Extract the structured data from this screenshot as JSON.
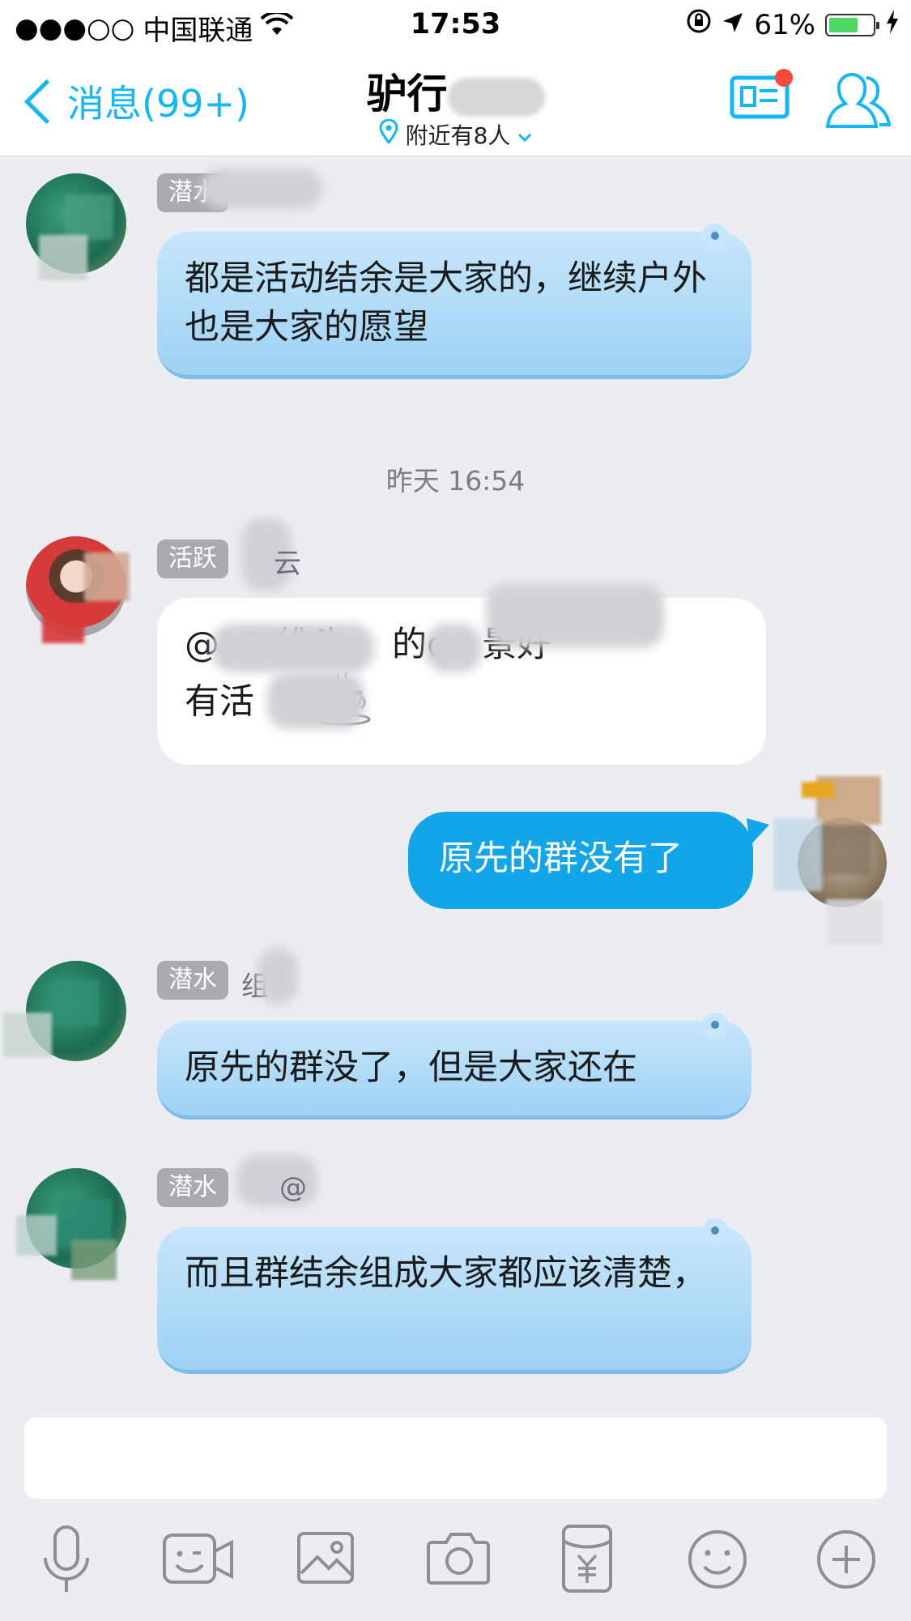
{
  "status_bar": {
    "signal": "●●●○○",
    "carrier": "中国联通",
    "time": "17:53",
    "battery_percent": "61%",
    "battery_level": 0.61
  },
  "nav": {
    "back_label": "消息(99+)",
    "title": "驴行",
    "subtitle": "附近有8人"
  },
  "messages": [
    {
      "sender_badge": "潜水",
      "sender_partial": "潜",
      "text": "都是活动结余是大家的，继续户外也是大家的愿望"
    },
    {
      "timestamp": "昨天 16:54"
    },
    {
      "sender_badge": "活跃",
      "sender_partial": "云",
      "text_line1": "@ @ 维头， 的qq    景好",
      "text_line2": "有活 "
    },
    {
      "self": true,
      "text": "原先的群没有了"
    },
    {
      "sender_badge": "潜水",
      "sender_partial": "组",
      "text": "原先的群没了，但是大家还在"
    },
    {
      "sender_badge": "潜水",
      "sender_partial": "@",
      "text": "而且群结余组成大家都应该清楚，"
    }
  ],
  "input": {
    "placeholder": ""
  },
  "toolbar": [
    "mic-icon",
    "video-icon",
    "image-icon",
    "camera-icon",
    "red-packet-icon",
    "emoji-icon",
    "plus-icon"
  ],
  "colors": {
    "accent": "#12b7f5",
    "self_bubble": "#12a6e8",
    "background": "#ebedf2"
  }
}
